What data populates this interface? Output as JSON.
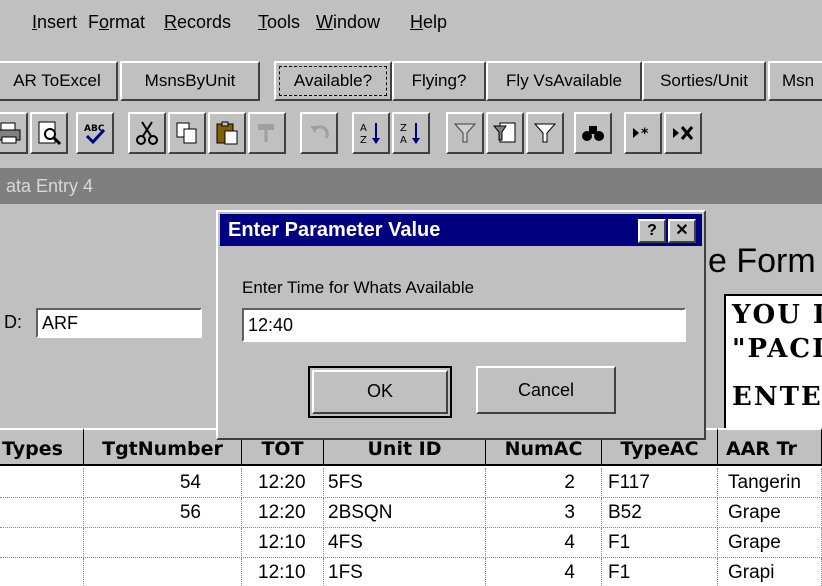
{
  "menu": {
    "items": [
      {
        "label": "Insert",
        "underline": "I"
      },
      {
        "label": "Format",
        "underline": "o"
      },
      {
        "label": "Records",
        "underline": "R"
      },
      {
        "label": "Tools",
        "underline": "T"
      },
      {
        "label": "Window",
        "underline": "W"
      },
      {
        "label": "Help",
        "underline": "H"
      }
    ]
  },
  "report_buttons": [
    "AR ToExcel",
    "MsnsByUnit",
    "Available?",
    "Flying?",
    "Fly VsAvailable",
    "Sorties/Unit",
    "Msn"
  ],
  "toolbar_icons": [
    "print-icon",
    "print-preview-icon",
    "spelling-icon",
    "cut-icon",
    "copy-icon",
    "paste-icon",
    "format-painter-icon",
    "undo-icon",
    "sort-ascending-icon",
    "sort-descending-icon",
    "filter-by-selection-icon",
    "filter-by-form-icon",
    "apply-filter-icon",
    "find-icon",
    "new-record-icon",
    "delete-record-icon"
  ],
  "form": {
    "title": "ata Entry 4",
    "heading": "e Form",
    "id_label": "D:",
    "id_value": "ARF",
    "warning_lines": [
      "YOU I",
      "\"PACI",
      "ENTE"
    ]
  },
  "dialog": {
    "title": "Enter Parameter Value",
    "help_glyph": "?",
    "close_glyph": "✕",
    "prompt": "Enter Time for Whats Available",
    "input_value": "12:40",
    "ok_label": "OK",
    "cancel_label": "Cancel"
  },
  "table": {
    "headers": [
      "Types",
      "TgtNumber",
      "TOT",
      "Unit ID",
      "NumAC",
      "TypeAC",
      "AAR Tr"
    ],
    "rows": [
      [
        "",
        "54",
        "12:20",
        "5FS",
        "2",
        "F117",
        "Tangerin"
      ],
      [
        "",
        "56",
        "12:20",
        "2BSQN",
        "3",
        "B52",
        "Grape"
      ],
      [
        "",
        "",
        "12:10",
        "4FS",
        "4",
        "F1",
        "Grape"
      ],
      [
        "",
        "",
        "12:10",
        "1FS",
        "4",
        "F1",
        "Grapi"
      ]
    ]
  }
}
